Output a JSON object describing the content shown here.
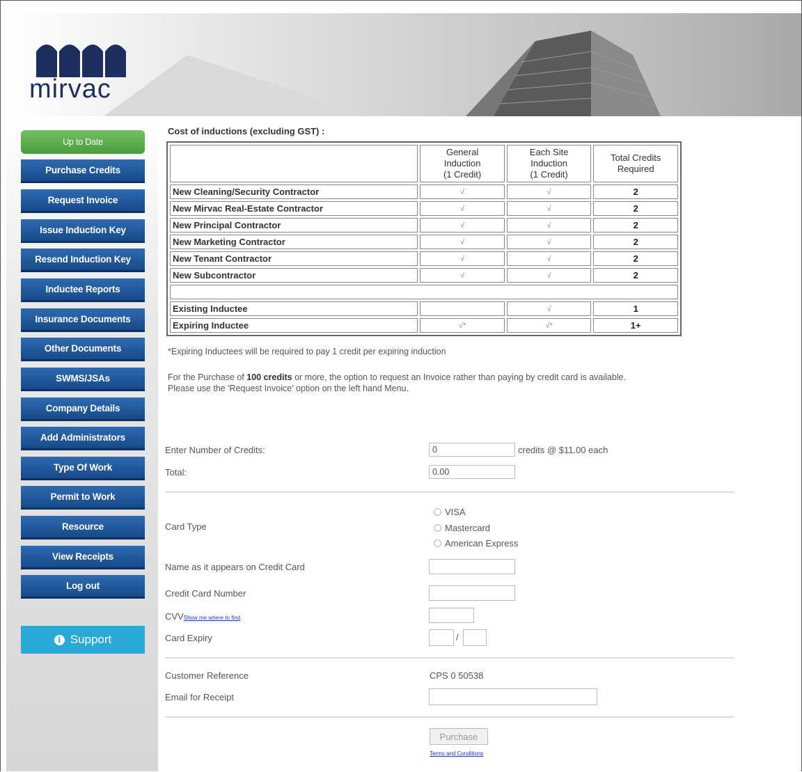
{
  "brand": {
    "name": "mirvac"
  },
  "sidebar": {
    "status_label": "Up to Date",
    "items": [
      {
        "label": "Purchase Credits"
      },
      {
        "label": "Request Invoice"
      },
      {
        "label": "Issue Induction Key"
      },
      {
        "label": "Resend Induction Key"
      },
      {
        "label": "Inductee Reports"
      },
      {
        "label": "Insurance Documents"
      },
      {
        "label": "Other Documents"
      },
      {
        "label": "SWMS/JSAs"
      },
      {
        "label": "Company Details"
      },
      {
        "label": "Add Administrators"
      },
      {
        "label": "Type Of Work"
      },
      {
        "label": "Permit to Work"
      },
      {
        "label": "Resource"
      },
      {
        "label": "View Receipts"
      },
      {
        "label": "Log out"
      }
    ],
    "support_label": "Support",
    "support_icon": "info-icon"
  },
  "cost_table": {
    "title": "Cost of inductions (excluding GST) :",
    "headers": {
      "general_line1": "General",
      "general_line2": "Induction",
      "general_line3": "(1 Credit)",
      "site_line1": "Each Site",
      "site_line2": "Induction",
      "site_line3": "(1 Credit)",
      "total_line1": "Total Credits",
      "total_line2": "Required"
    },
    "rows": [
      {
        "label": "New Cleaning/Security Contractor",
        "general": "√",
        "site": "√",
        "total": "2"
      },
      {
        "label": "New Mirvac Real-Estate Contractor",
        "general": "√",
        "site": "√",
        "total": "2"
      },
      {
        "label": "New Principal Contractor",
        "general": "√",
        "site": "√",
        "total": "2"
      },
      {
        "label": "New Marketing Contractor",
        "general": "√",
        "site": "√",
        "total": "2"
      },
      {
        "label": "New Tenant Contractor",
        "general": "√",
        "site": "√",
        "total": "2"
      },
      {
        "label": "New Subcontractor",
        "general": "√",
        "site": "√",
        "total": "2"
      }
    ],
    "rows2": [
      {
        "label": "Existing Inductee",
        "general": "",
        "site": "√",
        "total": "1"
      },
      {
        "label": "Expiring Inductee",
        "general": "√*",
        "site": "√*",
        "total": "1+"
      }
    ],
    "note": "*Expiring Inductees will be required to pay 1 credit per expiring induction"
  },
  "invoice_info": {
    "text_before": "For the Purchase of ",
    "bold": "100 credits",
    "text_after": " or more, the option to request an Invoice rather than paying by credit card is available.",
    "line2": "Please use the 'Request Invoice' option on the left hand Menu."
  },
  "form": {
    "credits_label": "Enter Number of Credits:",
    "credits_value": "0",
    "credits_suffix": "credits @ $11.00 each",
    "total_label": "Total:",
    "total_value": "0.00",
    "card_type_label": "Card Type",
    "card_options": [
      "VISA",
      "Mastercard",
      "American Express"
    ],
    "name_label": "Name as it appears on Credit Card",
    "name_value": "",
    "number_label": "Credit Card Number",
    "number_value": "",
    "cvv_label": "CVV",
    "cvv_link": "Show me where to find",
    "cvv_value": "",
    "expiry_label": "Card Expiry",
    "expiry_sep": "/",
    "expiry_month": "",
    "expiry_year": "",
    "customer_ref_label": "Customer Reference",
    "customer_ref_value": "CPS 0 50538",
    "email_label": "Email for Receipt",
    "email_value": "",
    "purchase_label": "Purchase",
    "terms_link": "Terms and Conditions"
  },
  "colors": {
    "nav_blue": "#174a8a",
    "status_green": "#4a9e3c",
    "support_blue": "#2aa8d8",
    "brand_navy": "#1d2f5e"
  }
}
